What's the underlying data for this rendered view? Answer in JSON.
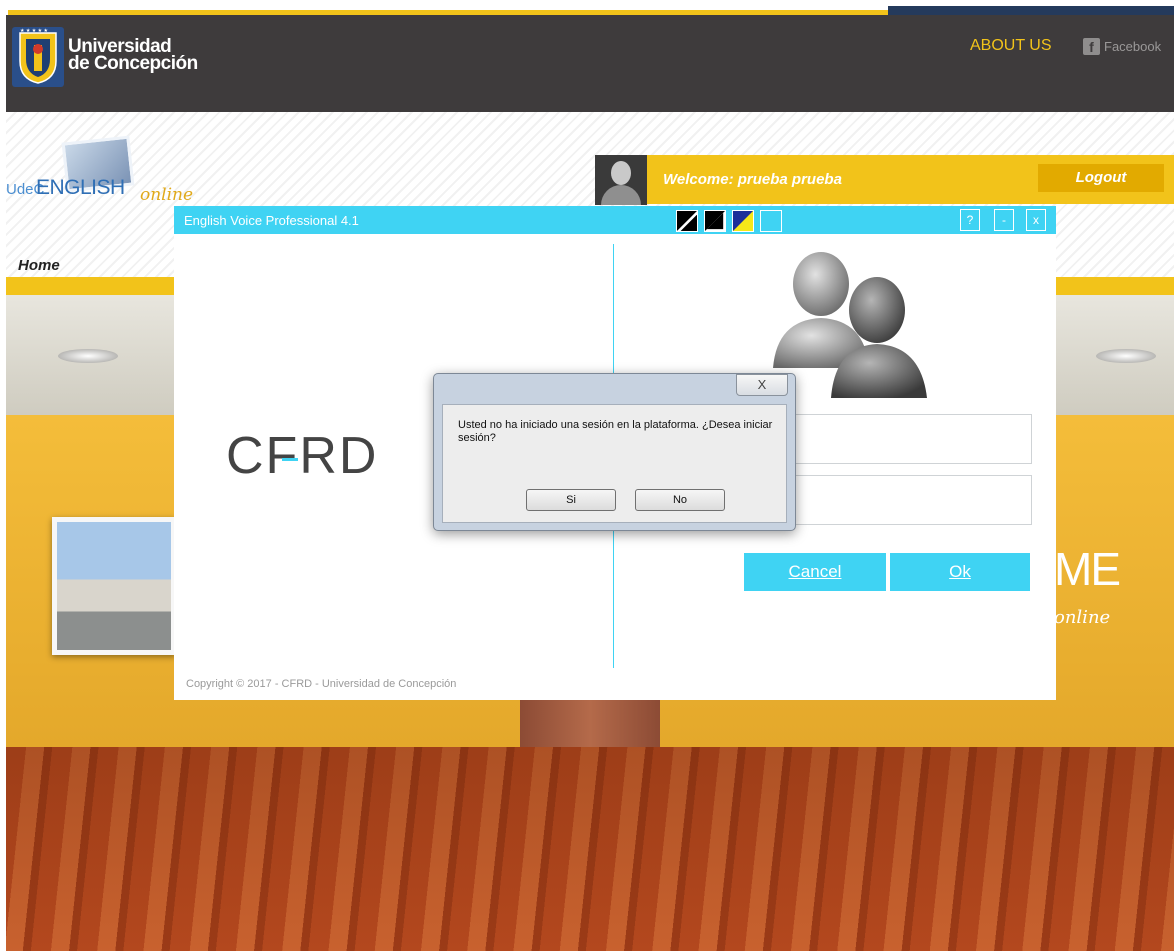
{
  "header": {
    "university_line1": "Universidad",
    "university_line2": "de Concepción",
    "about_link": "ABOUT US",
    "facebook_link": "Facebook"
  },
  "subheader": {
    "brand_udec": "UdeC",
    "brand_english": "ENGLISH",
    "brand_online": "online",
    "welcome": "Welcome: prueba prueba",
    "logout": "Logout",
    "breadcrumb": "Home"
  },
  "background": {
    "partial_welcome": "ME",
    "partial_online": "online"
  },
  "app_window": {
    "title": "English Voice Professional 4.1",
    "theme_swatches": [
      "black-white",
      "black-white-outline",
      "blue-yellow",
      "cyan"
    ],
    "help_button": "?",
    "minimize_button": "-",
    "close_button": "x",
    "logo_text": "CFRD",
    "cancel_button": "Cancel",
    "ok_button": "Ok",
    "copyright": "Copyright © 2017 - CFRD - Universidad de Concepción"
  },
  "dialog": {
    "close_glyph": "X",
    "message": "Usted no ha iniciado una sesión en la plataforma. ¿Desea iniciar sesión?",
    "yes_button": "Si",
    "no_button": "No"
  },
  "colors": {
    "header_bg": "#3e3b3c",
    "gold": "#f2c31a",
    "cyan": "#3fd3f3",
    "navy": "#243a5c"
  }
}
